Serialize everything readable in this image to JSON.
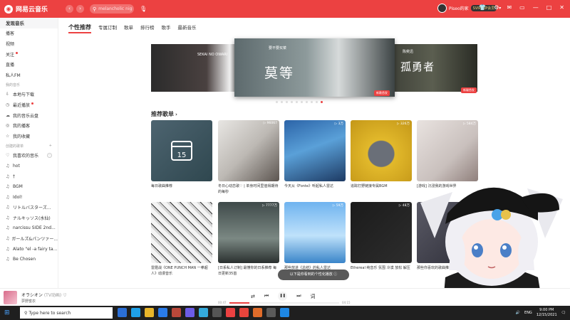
{
  "app": {
    "title": "网易云音乐",
    "search_placeholder": "melancholic night"
  },
  "user": {
    "name": "Piseo的家",
    "vip": "SVIP VIP会员"
  },
  "sidebar": {
    "items": [
      {
        "label": "发现音乐",
        "active": true
      },
      {
        "label": "播客"
      },
      {
        "label": "视频"
      },
      {
        "label": "关注",
        "dot": true
      },
      {
        "label": "直播"
      },
      {
        "label": "私人FM"
      }
    ],
    "my_music_header": "我的音乐",
    "my_music": [
      {
        "label": "本地与下载",
        "icon": "⇩"
      },
      {
        "label": "最近播放",
        "icon": "◷",
        "dot": true
      },
      {
        "label": "我的音乐云盘",
        "icon": "☁"
      },
      {
        "label": "我的播客",
        "icon": "◎"
      },
      {
        "label": "我的收藏",
        "icon": "☆"
      }
    ],
    "playlists_header": "创建的歌单",
    "playlists": [
      {
        "label": "我喜欢的音乐",
        "icon": "♡"
      },
      {
        "label": "hot",
        "icon": "♫"
      },
      {
        "label": "†",
        "icon": "♫"
      },
      {
        "label": "BGM",
        "icon": "♫"
      },
      {
        "label": "Idol!",
        "icon": "♫"
      },
      {
        "label": "リトルバスターズ...",
        "icon": "♫"
      },
      {
        "label": "ナルキッソス(水仙)",
        "icon": "♫"
      },
      {
        "label": "narcissu SIDE 2nd...",
        "icon": "♫"
      },
      {
        "label": "ガールズ&パンツァー...",
        "icon": "♫"
      },
      {
        "label": "Alato \"el -a fairy ta...",
        "icon": "♫"
      },
      {
        "label": "Be Chosen",
        "icon": "♫"
      }
    ]
  },
  "tabs": [
    "个性推荐",
    "专属订制",
    "歌单",
    "排行榜",
    "歌手",
    "最新音乐"
  ],
  "banner": {
    "center_title": "莫等",
    "center_sub": "要不要买菜",
    "center_tag": "新歌首发",
    "right_title": "孤勇者",
    "right_sub": "陈奕迅",
    "right_tag": "新碟首发",
    "left_sub": "SEKAI NO OWARI",
    "dot_count": 10,
    "active_dot": 9
  },
  "section": {
    "title": "推荐歌单",
    "arrow": "›"
  },
  "cards": [
    {
      "title": "每日歌曲推荐",
      "plays": ""
    },
    {
      "title": "冬日心动恋歌♡ | 单身时间里值得期待的每秒",
      "plays": "▷ 96067"
    },
    {
      "title": "今天从《Fonte》听起私人雷达",
      "plays": "▷ 3万"
    },
    {
      "title": "追踪打野链接专属BGM",
      "plays": "▷ 326万"
    },
    {
      "title": "[游戏] 沉浸我的游戏世界",
      "plays": "▷ 584万"
    },
    {
      "title": "雷霆战《ONE PUNCH MAN 一拳超人》动漫音乐",
      "plays": ""
    },
    {
      "title": "[日系私人订制] 最懂你的日系推荐 每日更新35首",
      "plays": "▷ 7777万"
    },
    {
      "title": "那些放进《总结》的私人雷达",
      "plays": "▷ 59万"
    },
    {
      "title": "Ethereal 纯音乐 氛围 冷漠 放松 解压",
      "plays": "▷ 48万"
    },
    {
      "title": "那些你喜欢的歌曲推荐",
      "plays": "▷ 3万"
    }
  ],
  "toast": "以下是你看到的个性化播放 ⓘ",
  "player": {
    "song": "オラシオン",
    "alias": "(TV动画)",
    "artist": "夢野蜜衣",
    "time_current": "00:47",
    "time_total": "04:15",
    "progress": 0.18
  },
  "taskbar": {
    "search_placeholder": "Type here to search",
    "lang": "ENG",
    "time": "9:00 PM",
    "date": "12/15/2021"
  },
  "colors": {
    "accent": "#ec4141"
  }
}
